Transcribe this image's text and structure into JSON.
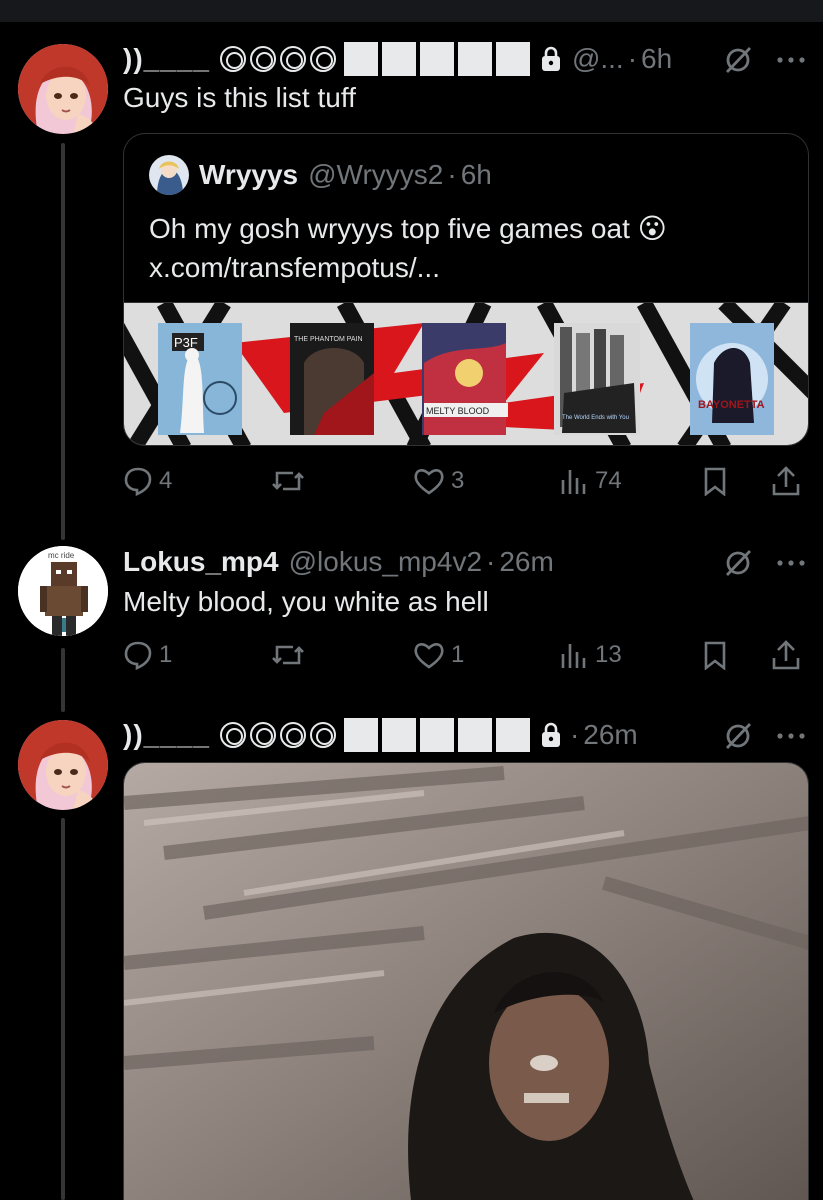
{
  "tweets": [
    {
      "display_name": "))____",
      "handle": "@...",
      "time": "6h",
      "text": "Guys is this list tuff",
      "quote": {
        "display_name": "Wryyys",
        "handle": "@Wryyys2",
        "time": "6h",
        "text_line1": "Oh my gosh wryyys top five games oat",
        "text_line2": "x.com/transfempotus/...",
        "emoji": "😮",
        "games": [
          "P3F",
          "THE PHANTOM PAIN",
          "MELTY BLOOD",
          "The World Ends with You",
          "BAYONETTA"
        ]
      },
      "stats": {
        "replies": "4",
        "likes": "3",
        "views": "74"
      }
    },
    {
      "display_name": "Lokus_mp4",
      "handle": "@lokus_mp4v2",
      "time": "26m",
      "text": "Melty blood, you white as hell",
      "avatar_caption": "mc ride",
      "stats": {
        "replies": "1",
        "likes": "1",
        "views": "13"
      }
    },
    {
      "display_name": "))____",
      "time": "26m",
      "media_alt": ""
    }
  ],
  "icons": [
    "reply-icon",
    "retweet-icon",
    "like-icon",
    "views-icon",
    "bookmark-icon",
    "share-icon",
    "grok-icon",
    "more-icon",
    "lock-icon"
  ],
  "colors": {
    "background": "#000000",
    "text": "#e7e9ea",
    "muted": "#71767b",
    "border": "#2f3336"
  }
}
